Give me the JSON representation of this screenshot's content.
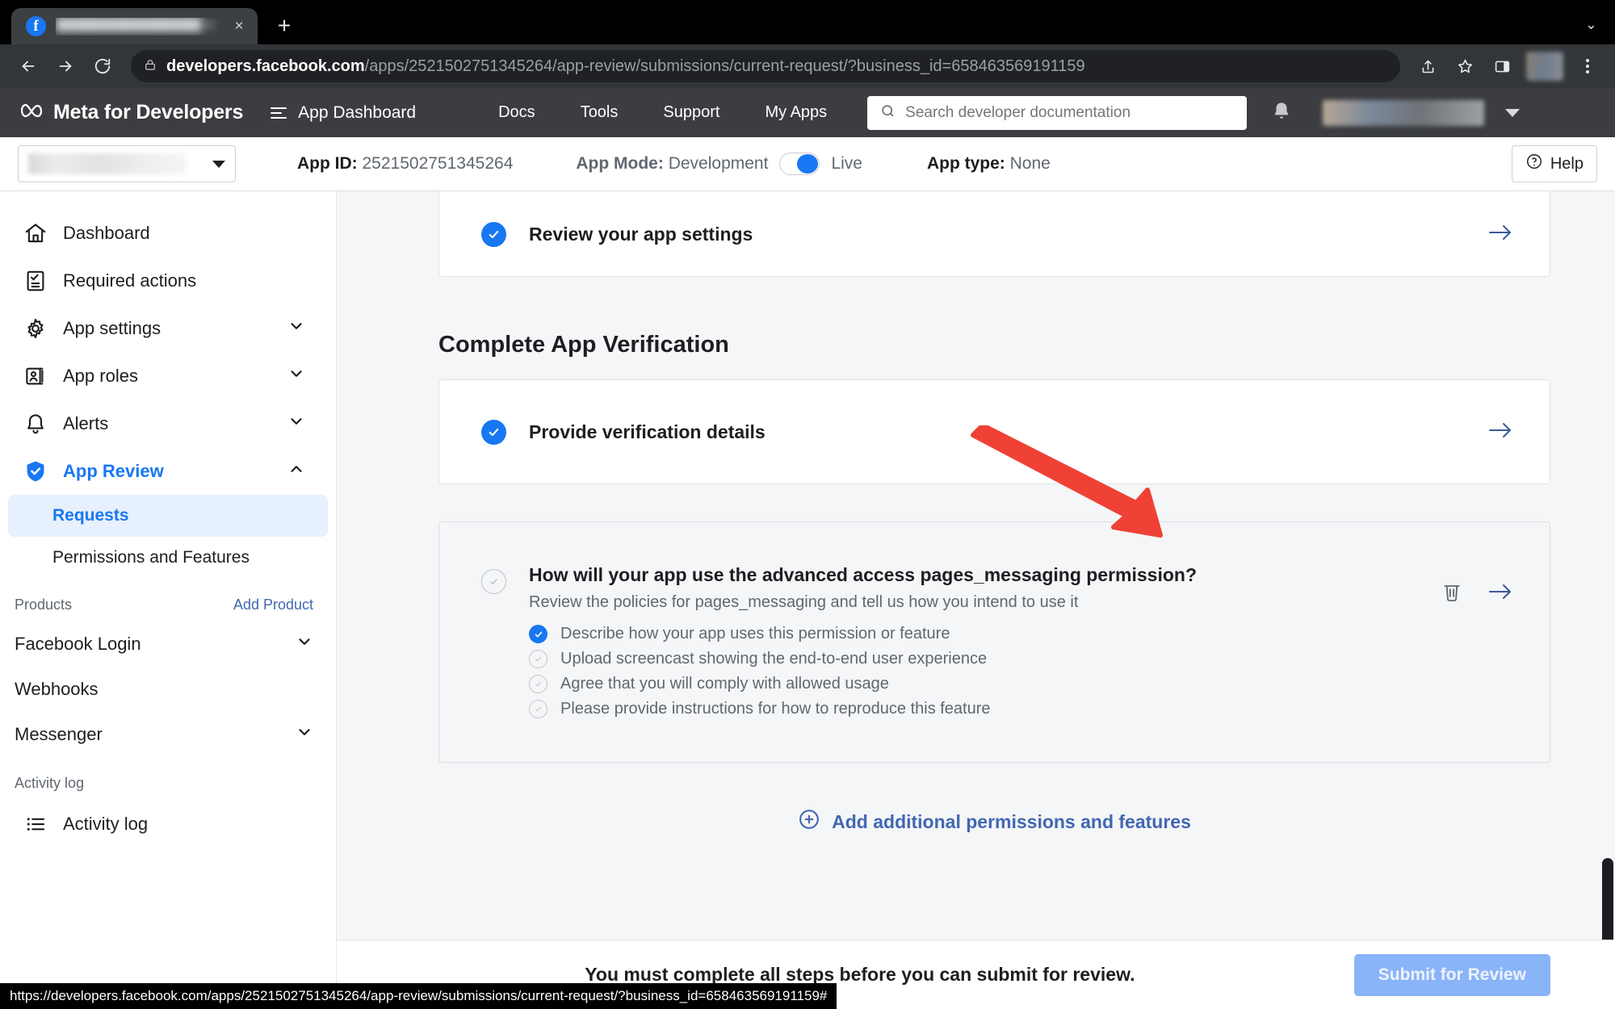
{
  "browser": {
    "tab": {
      "title": "█████████████████ ie",
      "close_label": "×"
    },
    "newtab_label": "+",
    "window_minimize_label": "⌄",
    "omnibox": {
      "host": "developers.facebook.com",
      "path": "/apps/2521502751345264/app-review/submissions/current-request/?business_id=658463569191159"
    },
    "status_url": "https://developers.facebook.com/apps/2521502751345264/app-review/submissions/current-request/?business_id=658463569191159#"
  },
  "meta_header": {
    "brand": "Meta for Developers",
    "dashboard_label": "App Dashboard",
    "nav": [
      {
        "label": "Docs"
      },
      {
        "label": "Tools"
      },
      {
        "label": "Support"
      },
      {
        "label": "My Apps"
      }
    ],
    "search_placeholder": "Search developer documentation"
  },
  "appbar": {
    "app_id_label": "App ID:",
    "app_id_value": "2521502751345264",
    "app_mode_label": "App Mode:",
    "app_mode_value": "Development",
    "app_mode_live": "Live",
    "app_type_label": "App type:",
    "app_type_value": "None",
    "help_label": "Help"
  },
  "sidebar": {
    "items": [
      {
        "label": "Dashboard",
        "icon": "home-icon",
        "expandable": false
      },
      {
        "label": "Required actions",
        "icon": "checklist-icon",
        "expandable": false
      },
      {
        "label": "App settings",
        "icon": "gear-icon",
        "expandable": true
      },
      {
        "label": "App roles",
        "icon": "id-card-icon",
        "expandable": true
      },
      {
        "label": "Alerts",
        "icon": "bell-icon",
        "expandable": true
      },
      {
        "label": "App Review",
        "icon": "shield-check-icon",
        "expandable": true,
        "active": true
      }
    ],
    "subitems": [
      {
        "label": "Requests",
        "selected": true
      },
      {
        "label": "Permissions and Features",
        "selected": false
      }
    ],
    "products_header": "Products",
    "add_product_label": "Add Product",
    "products": [
      {
        "label": "Facebook Login",
        "expandable": true
      },
      {
        "label": "Webhooks",
        "expandable": false
      },
      {
        "label": "Messenger",
        "expandable": true
      }
    ],
    "activity_header": "Activity log",
    "activity_item": {
      "label": "Activity log",
      "icon": "list-icon"
    }
  },
  "main": {
    "top_card": {
      "title": "Review your app settings",
      "state": "complete"
    },
    "section_title": "Complete App Verification",
    "verification_card": {
      "title": "Provide verification details",
      "state": "complete"
    },
    "permission_card": {
      "title": "How will your app use the advanced access pages_messaging permission?",
      "subtitle": "Review the policies for pages_messaging and tell us how you intend to use it",
      "state": "incomplete",
      "steps": [
        {
          "label": "Describe how your app uses this permission or feature",
          "done": true
        },
        {
          "label": "Upload screencast showing the end-to-end user experience",
          "done": false
        },
        {
          "label": "Agree that you will comply with allowed usage",
          "done": false
        },
        {
          "label": "Please provide instructions for how to reproduce this feature",
          "done": false
        }
      ],
      "delete_icon": "trash-icon",
      "open_icon": "arrow-right-icon"
    },
    "add_more_label": "Add additional permissions and features"
  },
  "footer": {
    "note": "You must complete all steps before you can submit for review.",
    "submit_label": "Submit for Review"
  },
  "colors": {
    "brand_blue": "#1877f2",
    "link_blue": "#4267b2",
    "annotation_red": "#ef4136",
    "disabled_button": "#8ab4f8"
  }
}
